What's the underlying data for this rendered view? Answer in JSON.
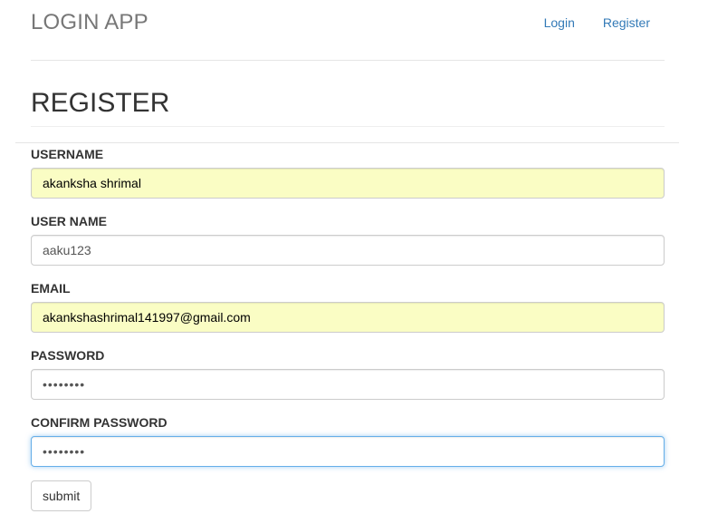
{
  "header": {
    "brand": "LOGIN APP",
    "nav": {
      "login": "Login",
      "register": "Register"
    }
  },
  "page_title": "REGISTER",
  "form": {
    "fields": [
      {
        "label": "USERNAME",
        "value": "akanksha shrimal",
        "type": "text",
        "autofilled": true
      },
      {
        "label": "USER NAME",
        "value": "aaku123",
        "type": "text",
        "autofilled": false
      },
      {
        "label": "EMAIL",
        "value": "akankshashrimal141997@gmail.com",
        "type": "email",
        "autofilled": true
      },
      {
        "label": "PASSWORD",
        "value": "aaku1234",
        "type": "password",
        "autofilled": false
      },
      {
        "label": "CONFIRM PASSWORD",
        "value": "aaku1234",
        "type": "password",
        "autofilled": false,
        "focused": true
      }
    ],
    "submit_label": "submit"
  },
  "colors": {
    "link": "#337ab7",
    "brand": "#777777",
    "autofill_bg": "#fafdc4",
    "focus_border": "#66afe9"
  }
}
